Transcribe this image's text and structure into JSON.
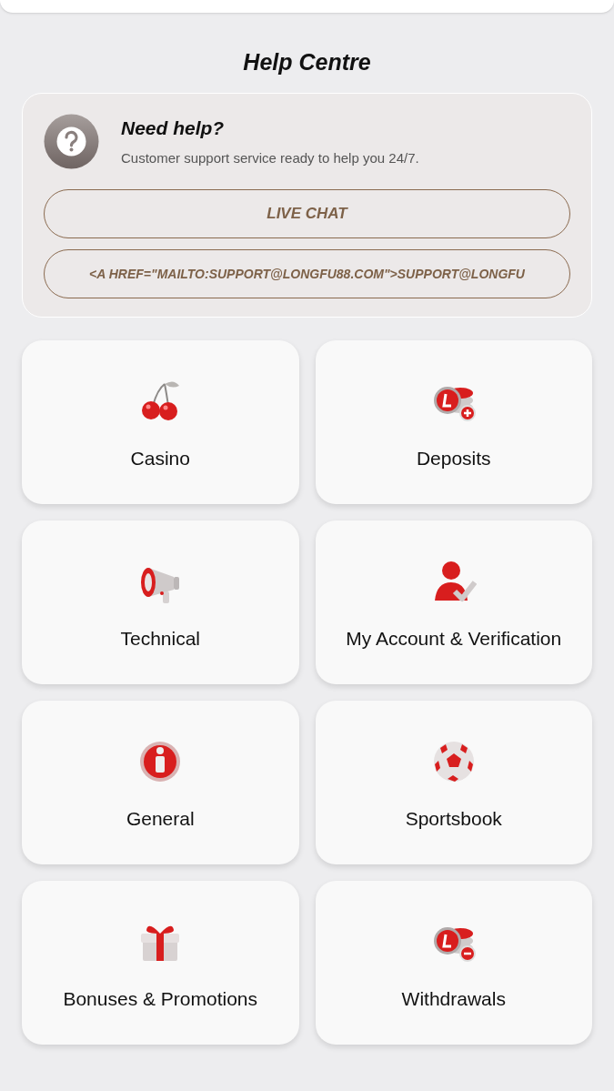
{
  "title": "Help Centre",
  "help_card": {
    "heading": "Need help?",
    "text": "Customer support service ready to help you 24/7.",
    "buttons": [
      "LIVE CHAT",
      "<A HREF=\"MAILTO:SUPPORT@LONGFU88.COM\">SUPPORT@LONGFU"
    ]
  },
  "categories": [
    {
      "label": "Casino",
      "kind": "cherries"
    },
    {
      "label": "Deposits",
      "kind": "coins-plus"
    },
    {
      "label": "Technical",
      "kind": "megaphone"
    },
    {
      "label": "My Account & Verification",
      "kind": "user-check"
    },
    {
      "label": "General",
      "kind": "info"
    },
    {
      "label": "Sportsbook",
      "kind": "ball"
    },
    {
      "label": "Bonuses & Promotions",
      "kind": "gift"
    },
    {
      "label": "Withdrawals",
      "kind": "coins-minus"
    }
  ]
}
